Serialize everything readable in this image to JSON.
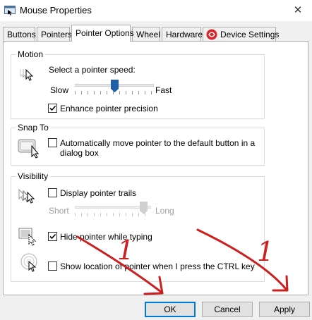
{
  "window": {
    "title": "Mouse Properties",
    "close_glyph": "✕"
  },
  "tabs": [
    {
      "label": "Buttons"
    },
    {
      "label": "Pointers"
    },
    {
      "label": "Pointer Options"
    },
    {
      "label": "Wheel"
    },
    {
      "label": "Hardware"
    },
    {
      "label": "Device Settings"
    }
  ],
  "active_tab": "Pointer Options",
  "motion": {
    "title": "Motion",
    "speed_label": "Select a pointer speed:",
    "slow_label": "Slow",
    "fast_label": "Fast",
    "speed_level": 0.55,
    "enhance_label": "Enhance pointer precision",
    "enhance_checked": true
  },
  "snap_to": {
    "title": "Snap To",
    "checkbox_label_line1": "Automatically move pointer to the default button in a",
    "checkbox_label_line2": "dialog box",
    "checked": false
  },
  "visibility": {
    "title": "Visibility",
    "trails_label": "Display pointer trails",
    "trails_checked": false,
    "short_label": "Short",
    "long_label": "Long",
    "trails_level": 1.0,
    "hide_label": "Hide pointer while typing",
    "hide_checked": true,
    "show_location_label": "Show location of pointer when I press the CTRL key",
    "show_location_checked": false
  },
  "buttons": {
    "ok": "OK",
    "cancel": "Cancel",
    "apply": "Apply"
  },
  "annotations": {
    "left_mark": "1",
    "right_mark": "1",
    "arrow_color": "#cc1f1f"
  },
  "colors": {
    "accent": "#0078d7",
    "slider_thumb": "#1e5fa8",
    "device_icon": "#d7262b"
  }
}
